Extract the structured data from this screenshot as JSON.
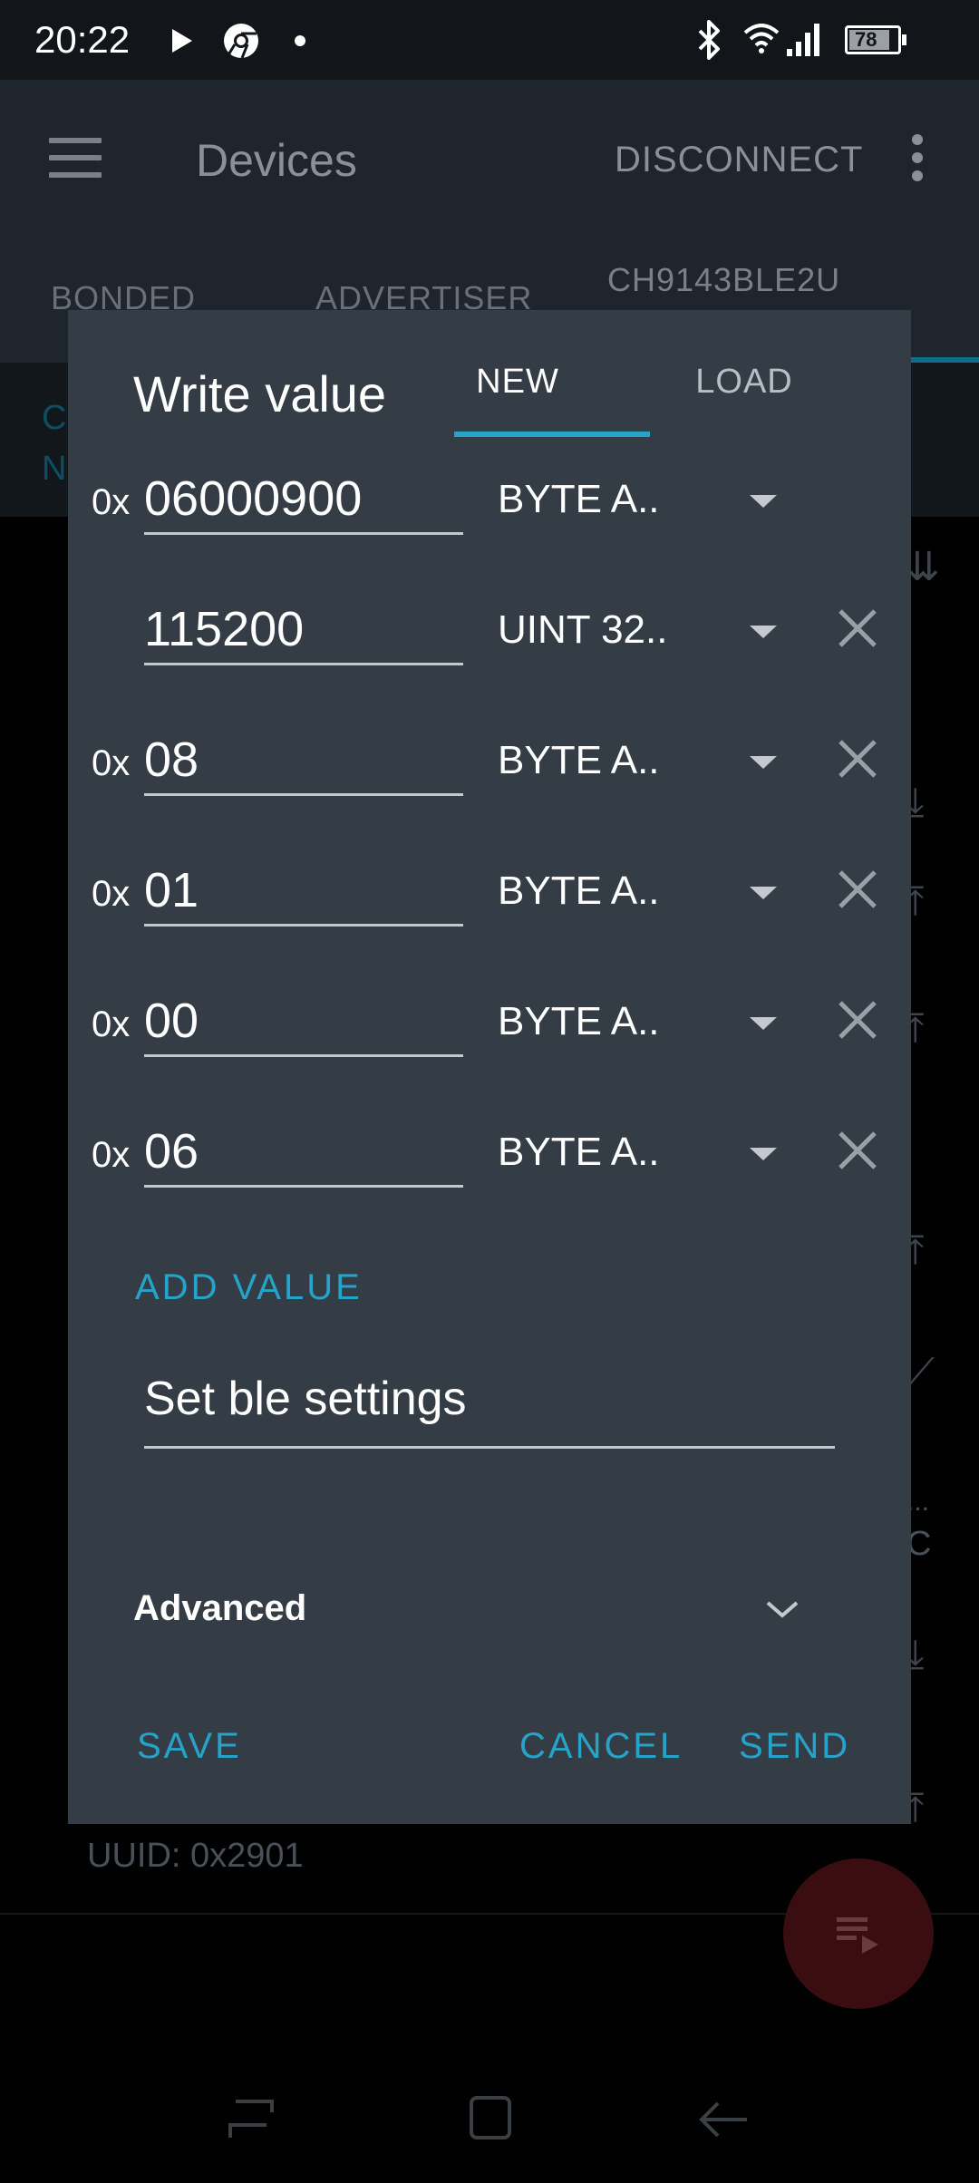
{
  "status_bar": {
    "time": "20:22",
    "battery": "78",
    "icons": [
      "play-icon",
      "chrome-icon",
      "dot-icon",
      "bluetooth-icon",
      "wifi-icon",
      "signal-icon",
      "battery-icon"
    ]
  },
  "app_bar": {
    "title": "Devices",
    "disconnect_label": "DISCONNECT",
    "tabs": [
      {
        "label": "BONDED"
      },
      {
        "label": "ADVERTISER"
      },
      {
        "label": "CH9143BLE2U"
      }
    ]
  },
  "background": {
    "header_line1": "C",
    "header_line2": "N",
    "peek_line1": "...",
    "peek_line2": "C",
    "uuid_label": "UUID:",
    "uuid_value": "0x2901"
  },
  "dialog": {
    "title": "Write value",
    "tabs": [
      {
        "label": "NEW",
        "selected": true
      },
      {
        "label": "LOAD",
        "selected": false
      }
    ],
    "rows": [
      {
        "prefix": "0x",
        "value": "06000900",
        "type": "BYTE A..",
        "removable": false
      },
      {
        "prefix": "",
        "value": "115200",
        "type": "UINT 32..",
        "removable": true
      },
      {
        "prefix": "0x",
        "value": "08",
        "type": "BYTE A..",
        "removable": true
      },
      {
        "prefix": "0x",
        "value": "01",
        "type": "BYTE A..",
        "removable": true
      },
      {
        "prefix": "0x",
        "value": "00",
        "type": "BYTE A..",
        "removable": true
      },
      {
        "prefix": "0x",
        "value": "06",
        "type": "BYTE A..",
        "removable": true
      }
    ],
    "add_value_label": "ADD VALUE",
    "description": "Set ble settings",
    "advanced_label": "Advanced",
    "buttons": {
      "save": "SAVE",
      "cancel": "CANCEL",
      "send": "SEND"
    }
  },
  "colors": {
    "accent": "#27a3c9",
    "dialog_bg": "#343d46",
    "fab": "#3a0d10"
  }
}
